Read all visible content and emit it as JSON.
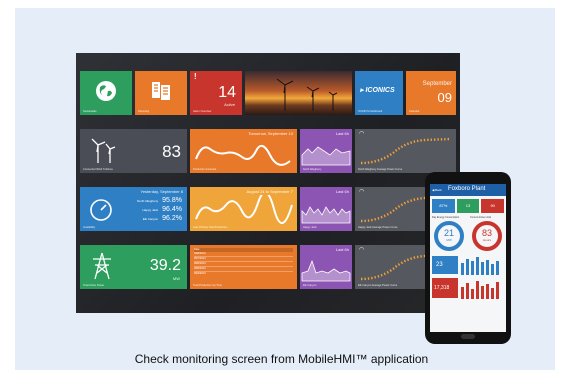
{
  "caption": "Check monitoring screen from MobileHMI™ application",
  "colors": {
    "green": "#2e9e5e",
    "orange": "#e8792b",
    "red": "#c8352c",
    "blue": "#2f7fc4",
    "purple": "#8c55b3",
    "dark": "#4a4d55"
  },
  "tiles": {
    "energy": {
      "label": "Sustainable",
      "icon": "globe-icon"
    },
    "reporting": {
      "label": "Reporting",
      "icon": "report-icon"
    },
    "alarms": {
      "value": "14",
      "unit": "Active",
      "label": "Alarm Overview",
      "mark": "!"
    },
    "logo": {
      "text": "▸ ICONICS",
      "label": "ICONICS Dashboard"
    },
    "calendar": {
      "month": "September",
      "day": "09",
      "label": "Calendar"
    },
    "turbines": {
      "value": "83",
      "label": "Connected Wind Turbines"
    },
    "production": {
      "header": "Tomorrow, September 10",
      "label": "Production Forecast"
    },
    "north1": {
      "header": "Last 6h",
      "label": "North Allegheny"
    },
    "north_curve": {
      "label": "North Allegheny Average Power Curve"
    },
    "availability": {
      "header": "Yesterday, September 8",
      "label": "Availability",
      "rows": [
        {
          "name": "North Allegheny",
          "value": "95.8%"
        },
        {
          "name": "Happy Jack",
          "value": "96.4%"
        },
        {
          "name": "Elk Canyon",
          "value": "96.2%"
        }
      ]
    },
    "lastdays": {
      "header": "August 24 to September 7",
      "label": "Last 15 Days Total Production"
    },
    "happy": {
      "header": "Last 6h",
      "label": "Happy Jack"
    },
    "happy_curve": {
      "label": "Happy Jack Average Power Curve"
    },
    "grid": {
      "value": "39.2",
      "unit": "MW",
      "label": "Total Active Power"
    },
    "table": {
      "label": "Total Production Up Time",
      "header": [
        "Date",
        "",
        "",
        "",
        ""
      ],
      "rows": [
        [
          "09/8/2014",
          "",
          "",
          "",
          ""
        ],
        [
          "09/7/2014",
          "",
          "",
          "",
          ""
        ],
        [
          "09/6/2014",
          "",
          "",
          "",
          ""
        ],
        [
          "09/5/2014",
          "",
          "",
          "",
          ""
        ],
        [
          "09/4/2014",
          "",
          "",
          "",
          ""
        ]
      ]
    },
    "elk": {
      "header": "Last 6h",
      "label": "Elk Canyon"
    },
    "elk_curve": {
      "label": "Elk Canyon Average Power Curve"
    }
  },
  "phone": {
    "app_title": "Foxboro Plant",
    "back": "◀ Back",
    "tiles": [
      "87%",
      "13",
      "90"
    ],
    "gauge_left": {
      "value": "21",
      "unit": "MW",
      "label": "Day Energy Consumption"
    },
    "gauge_right": {
      "value": "83",
      "unit": "Hours",
      "label": "Current Active Units"
    },
    "small_value": "23",
    "bottom_value": "17,318"
  }
}
